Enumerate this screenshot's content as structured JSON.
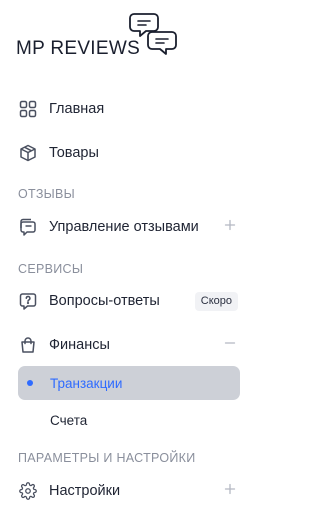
{
  "brand": {
    "name": "MP REVIEWS",
    "logo_icon": "chat-bubbles-icon"
  },
  "nav": {
    "home": {
      "label": "Главная",
      "icon": "grid-icon"
    },
    "products": {
      "label": "Товары",
      "icon": "box-icon"
    },
    "section_reviews": "ОТЗЫВЫ",
    "reviews_manage": {
      "label": "Управление отзывами",
      "icon": "chat-icon"
    },
    "section_services": "СЕРВИСЫ",
    "qa": {
      "label": "Вопросы-ответы",
      "icon": "question-chat-icon",
      "badge": "Скоро"
    },
    "finance": {
      "label": "Финансы",
      "icon": "bag-icon",
      "expanded": true,
      "children": [
        {
          "label": "Транзакции",
          "active": true
        },
        {
          "label": "Счета",
          "active": false
        }
      ]
    },
    "section_settings": "ПАРАМЕТРЫ И НАСТРОЙКИ",
    "settings": {
      "label": "Настройки",
      "icon": "gear-icon"
    }
  },
  "colors": {
    "accent": "#2f6bff",
    "active_bg": "#cdd0d7",
    "muted": "#8a8f9c",
    "text": "#1f2433"
  }
}
